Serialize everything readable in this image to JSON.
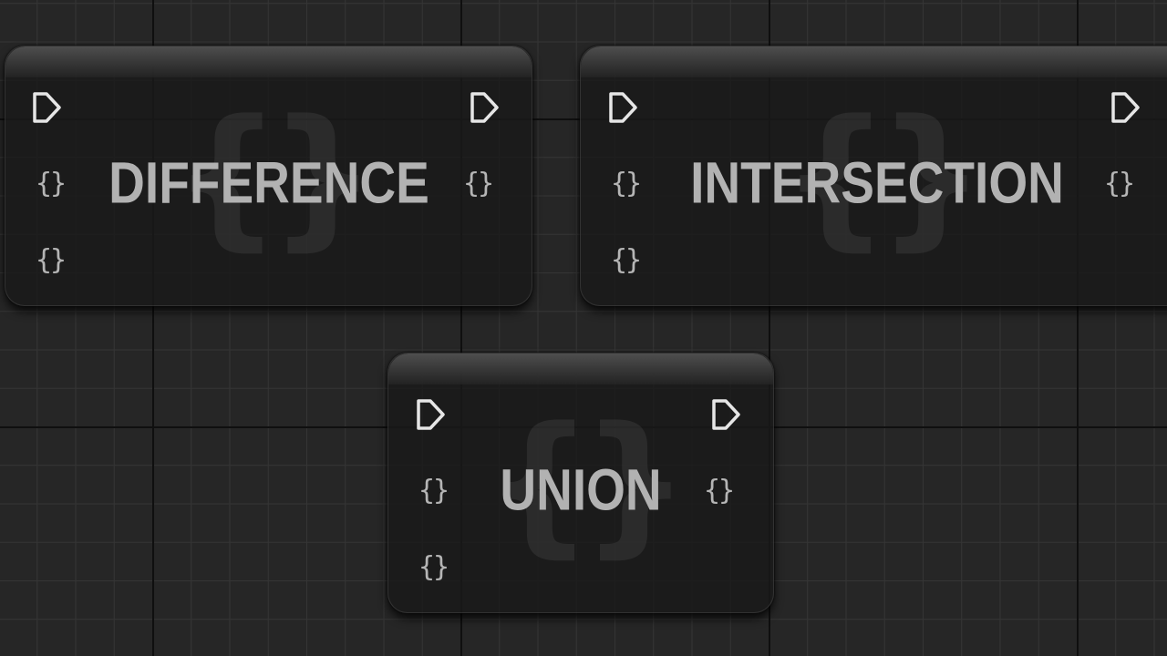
{
  "graph": {
    "nodes": [
      {
        "id": "difference",
        "title": "DIFFERENCE",
        "watermark_glyph": "{}",
        "exec_in_icon": "exec-pin-icon",
        "exec_out_icon": "exec-pin-icon",
        "inputs": [
          "{}",
          "{}"
        ],
        "outputs": [
          "{}"
        ]
      },
      {
        "id": "intersection",
        "title": "INTERSECTION",
        "watermark_glyph": "{}",
        "exec_in_icon": "exec-pin-icon",
        "exec_out_icon": "exec-pin-icon",
        "inputs": [
          "{}",
          "{}"
        ],
        "outputs": [
          "{}"
        ]
      },
      {
        "id": "union",
        "title": "UNION",
        "watermark_glyph": "{}",
        "exec_in_icon": "exec-pin-icon",
        "exec_out_icon": "exec-pin-icon",
        "inputs": [
          "{}",
          "{}"
        ],
        "outputs": [
          "{}"
        ]
      }
    ]
  },
  "colors": {
    "canvas_background": "#262626",
    "node_body": "#1f1f1f",
    "title_text": "#b2b2b2",
    "pin_color": "#e6e6e6",
    "struct_pin_color": "#b5b5b5"
  }
}
